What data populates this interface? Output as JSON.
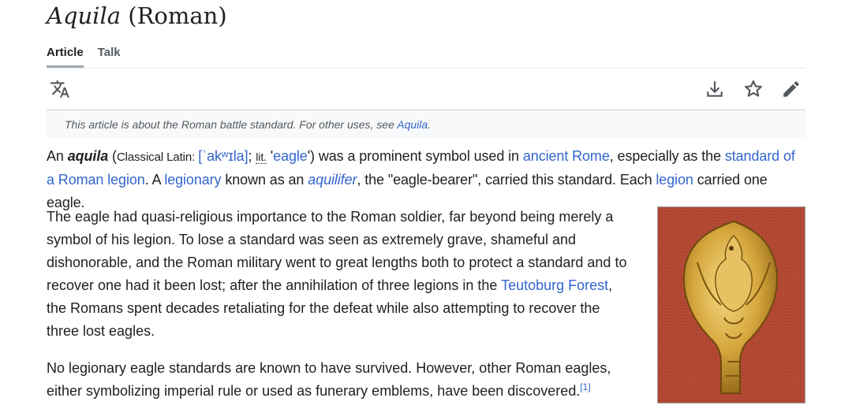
{
  "page": {
    "title_italic": "Aquila",
    "title_rest": " (Roman)"
  },
  "tabs": [
    {
      "label": "Article",
      "active": true
    },
    {
      "label": "Talk",
      "active": false
    }
  ],
  "toolbar": {
    "language_icon": "translate-icon",
    "download_icon": "download-icon",
    "watch_icon": "star-icon",
    "edit_icon": "pencil-icon"
  },
  "hatnote": {
    "text": "This article is about the Roman battle standard. For other uses, see ",
    "link": "Aquila",
    "end": "."
  },
  "p1": {
    "t1": "An ",
    "term": "aquila",
    "t2": " (",
    "lang": "Classical Latin",
    "t3": ": ",
    "ipa": "[ˈakʷɪla]",
    "t4": "; ",
    "lit": "lit.",
    "t5": " '",
    "eagle": "eagle",
    "t6": "') was a prominent symbol used in ",
    "link_rome": "ancient Rome",
    "t7": ", especially as the ",
    "link_standard": "standard of a Roman legion",
    "t8": ". A ",
    "link_legionary": "legionary",
    "t9": " known as an ",
    "link_aquilifer": "aquilifer",
    "t10": ", the \"eagle-bearer\", carried this standard. Each ",
    "link_legion": "legion",
    "t11": " carried one eagle."
  },
  "p2": {
    "t1": "The eagle had quasi-religious importance to the Roman soldier, far beyond being merely a symbol of his legion. To lose a standard was seen as extremely grave, shameful and dishonorable, and the Roman military went to great lengths both to protect a standard and to recover one had it been lost; after the annihilation of three legions in the ",
    "link": "Teutoburg Forest",
    "t2": ", the Romans spent decades retaliating for the defeat while also attempting to recover the three lost eagles."
  },
  "p3": {
    "t1": "No legionary eagle standards are known to have survived. However, other Roman eagles, either symbolizing imperial rule or used as funerary emblems, have been discovered.",
    "ref": "[1]"
  },
  "figure": {
    "subject": "golden-eagle-figurine"
  }
}
